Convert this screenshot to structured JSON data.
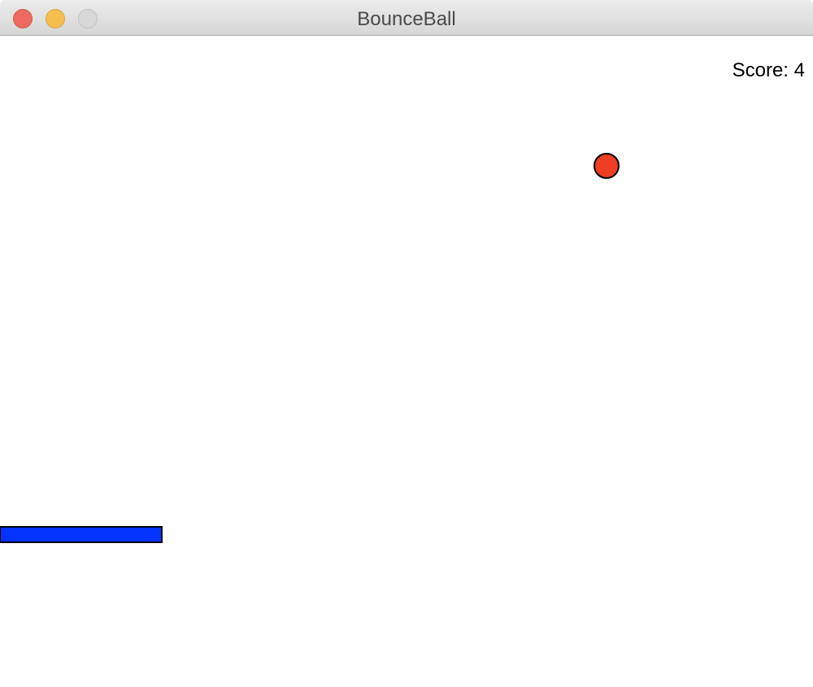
{
  "window": {
    "title": "BounceBall"
  },
  "game": {
    "score_text": "Score: 4",
    "ball_color": "#ee3e24",
    "paddle_color": "#0433ff",
    "background_color": "#ffffff"
  },
  "icons": {
    "close": "close-icon",
    "minimize": "minimize-icon",
    "zoom": "zoom-icon"
  }
}
